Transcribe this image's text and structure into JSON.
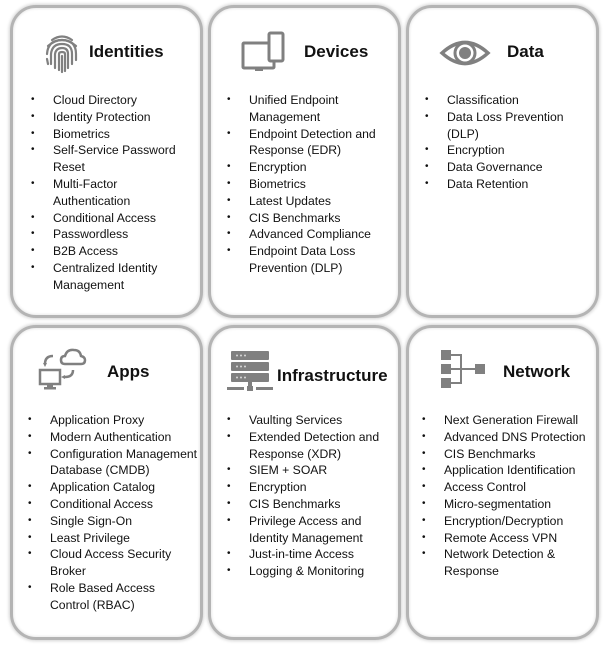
{
  "colors": {
    "border": "#b4b4b4",
    "icon": "#808080",
    "text": "#111111"
  },
  "cards": [
    {
      "title": "Identities",
      "icon": "fingerprint-icon",
      "items": [
        "Cloud Directory",
        "Identity Protection",
        "Biometrics",
        "Self-Service Password Reset",
        "Multi-Factor Authentication",
        "Conditional Access",
        "Passwordless",
        "B2B Access",
        "Centralized Identity Management"
      ]
    },
    {
      "title": "Devices",
      "icon": "devices-icon",
      "items": [
        "Unified Endpoint Management",
        "Endpoint Detection and Response (EDR)",
        "Encryption",
        "Biometrics",
        "Latest Updates",
        "CIS Benchmarks",
        "Advanced Compliance",
        "Endpoint Data Loss Prevention (DLP)"
      ]
    },
    {
      "title": "Data",
      "icon": "eye-icon",
      "items": [
        "Classification",
        "Data Loss Prevention (DLP)",
        "Encryption",
        "Data Governance",
        "Data Retention"
      ]
    },
    {
      "title": "Apps",
      "icon": "cloud-computer-sync-icon",
      "items": [
        "Application Proxy",
        "Modern Authentication",
        "Configuration Management Database (CMDB)",
        "Application Catalog",
        "Conditional Access",
        "Single Sign-On",
        "Least Privilege",
        "Cloud Access Security Broker",
        "Role Based Access Control (RBAC)"
      ]
    },
    {
      "title": "Infrastructure",
      "icon": "server-rack-icon",
      "items": [
        "Vaulting Services",
        "Extended Detection and Response (XDR)",
        "SIEM + SOAR",
        "Encryption",
        "CIS Benchmarks",
        "Privilege Access and Identity Management",
        "Just-in-time Access",
        "Logging & Monitoring"
      ]
    },
    {
      "title": "Network",
      "icon": "network-hierarchy-icon",
      "items": [
        "Next Generation Firewall",
        "Advanced DNS Protection",
        "CIS Benchmarks",
        "Application Identification",
        "Access Control",
        "Micro-segmentation",
        "Encryption/Decryption",
        "Remote Access VPN",
        "Network Detection & Response"
      ]
    }
  ]
}
